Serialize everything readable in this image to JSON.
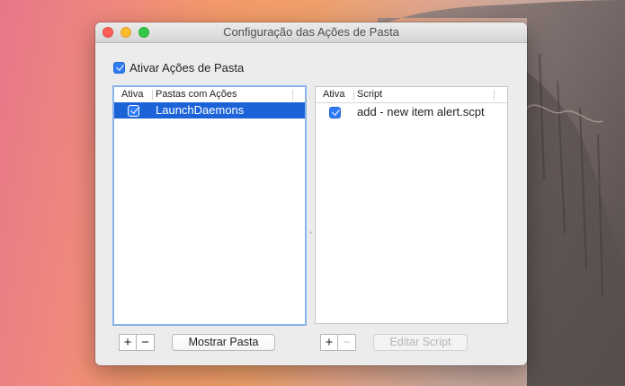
{
  "window": {
    "title": "Configuração das Ações de Pasta"
  },
  "master_toggle": {
    "label": "Ativar Ações de Pasta",
    "checked": true
  },
  "folders_table": {
    "columns": [
      "Ativa",
      "Pastas com Ações"
    ],
    "rows": [
      {
        "active": true,
        "name": "LaunchDaemons",
        "selected": true
      }
    ]
  },
  "scripts_table": {
    "columns": [
      "Ativa",
      "Script"
    ],
    "rows": [
      {
        "active": true,
        "name": "add - new item alert.scpt",
        "selected": false
      }
    ]
  },
  "folders_buttons": {
    "add": "+",
    "remove": "−",
    "show_folder": "Mostrar Pasta"
  },
  "scripts_buttons": {
    "add": "+",
    "remove": "−",
    "edit_script": "Editar Script"
  },
  "colors": {
    "accent": "#1d63d8",
    "checkbox": "#2f7cf6"
  }
}
